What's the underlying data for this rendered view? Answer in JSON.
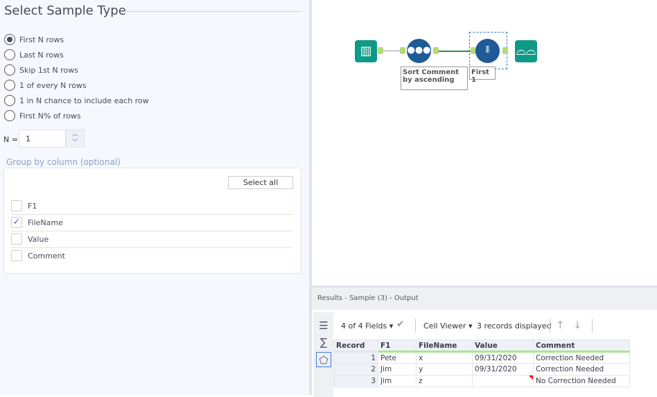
{
  "config": {
    "title": "Select Sample Type",
    "options": [
      {
        "label": "First N rows",
        "selected": true
      },
      {
        "label": "Last N rows",
        "selected": false
      },
      {
        "label": "Skip 1st N rows",
        "selected": false
      },
      {
        "label": "1 of every N rows",
        "selected": false
      },
      {
        "label": "1 in N chance to include each row",
        "selected": false
      },
      {
        "label": "First N% of rows",
        "selected": false
      }
    ],
    "n_label": "N =",
    "n_value": "1",
    "group_label": "Group by column (optional)",
    "select_all": "Select all",
    "columns": [
      {
        "label": "F1",
        "checked": false
      },
      {
        "label": "FileName",
        "checked": true
      },
      {
        "label": "Value",
        "checked": false
      },
      {
        "label": "Comment",
        "checked": false
      }
    ]
  },
  "workflow": {
    "sort_annotation": "Sort Comment by ascending",
    "sample_annotation": "First 1"
  },
  "results": {
    "header": "Results - Sample (3) - Output",
    "fields": "4 of 4 Fields",
    "viewer": "Cell Viewer",
    "records": "3 records displayed",
    "columns": [
      "Record",
      "F1",
      "FileName",
      "Value",
      "Comment"
    ],
    "rows": [
      [
        "1",
        "Pete",
        "x",
        "09/31/2020",
        "Correction Needed"
      ],
      [
        "2",
        "Jim",
        "y",
        "09/31/2020",
        "Correction Needed"
      ],
      [
        "3",
        "Jim",
        "z",
        "",
        "No Correction Needed"
      ]
    ]
  }
}
